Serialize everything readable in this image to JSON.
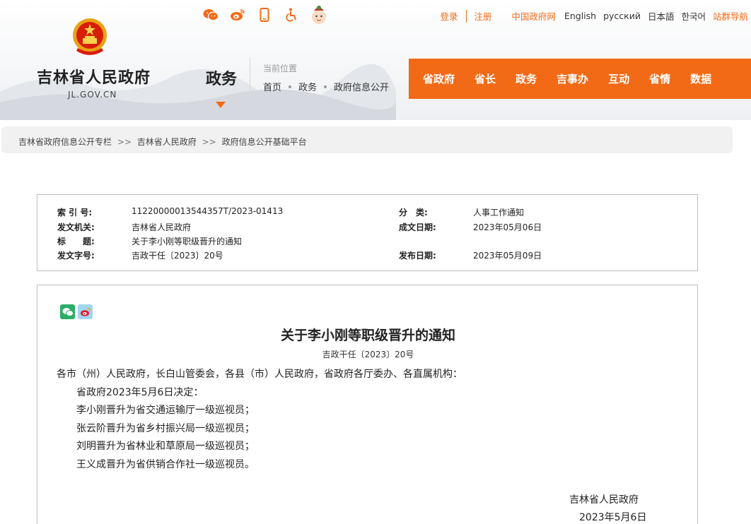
{
  "header": {
    "site_name": "吉林省人民政府",
    "site_domain": "JL.GOV.CN",
    "section_title": "政务",
    "current_position_label": "当前位置",
    "position_crumbs": [
      "首页",
      "政务",
      "政府信息公开"
    ],
    "top_icons": [
      "weixin-icon",
      "weibo-icon",
      "mobile-icon",
      "accessibility-icon",
      "mascot-icon"
    ],
    "top_links": {
      "login": "登录",
      "register": "注册",
      "gov_net": "中国政府网",
      "english": "English",
      "russian": "русский",
      "japanese": "日本語",
      "korean": "한국어",
      "site_groups": "站群导航"
    },
    "nav": [
      "省政府",
      "省长",
      "政务",
      "吉事办",
      "互动",
      "省情",
      "数据"
    ],
    "accent_color": "#f36a16"
  },
  "breadcrumb": [
    "吉林省政府信息公开专栏",
    "吉林省人民政府",
    "政府信息公开基础平台"
  ],
  "breadcrumb_separator": ">>",
  "meta": {
    "index_no_label": "索 引 号:",
    "index_no": "11220000013544357T/2023-01413",
    "category_label": "分　类:",
    "category": "人事工作通知",
    "issuer_label": "发文机关:",
    "issuer": "吉林省人民政府",
    "date_label": "成文日期:",
    "date": "2023年05月06日",
    "title_label": "标　　题:",
    "title": "关于李小刚等职级晋升的通知",
    "doc_no_label": "发文字号:",
    "doc_no": "吉政干任〔2023〕20号",
    "publish_label": "发布日期:",
    "publish_date": "2023年05月09日"
  },
  "document": {
    "share_icons": [
      "wechat-share-icon",
      "weibo-share-icon"
    ],
    "title": "关于李小刚等职级晋升的通知",
    "number": "吉政干任〔2023〕20号",
    "lines": [
      "各市（州）人民政府，长白山管委会，各县（市）人民政府，省政府各厅委办、各直属机构：",
      "省政府2023年5月6日决定：",
      "李小刚晋升为省交通运输厅一级巡视员；",
      "张云阶晋升为省乡村振兴局一级巡视员；",
      "刘明晋升为省林业和草原局一级巡视员；",
      "王义成晋升为省供销合作社一级巡视员。"
    ],
    "signer": "吉林省人民政府",
    "sign_date": "2023年5月6日"
  }
}
